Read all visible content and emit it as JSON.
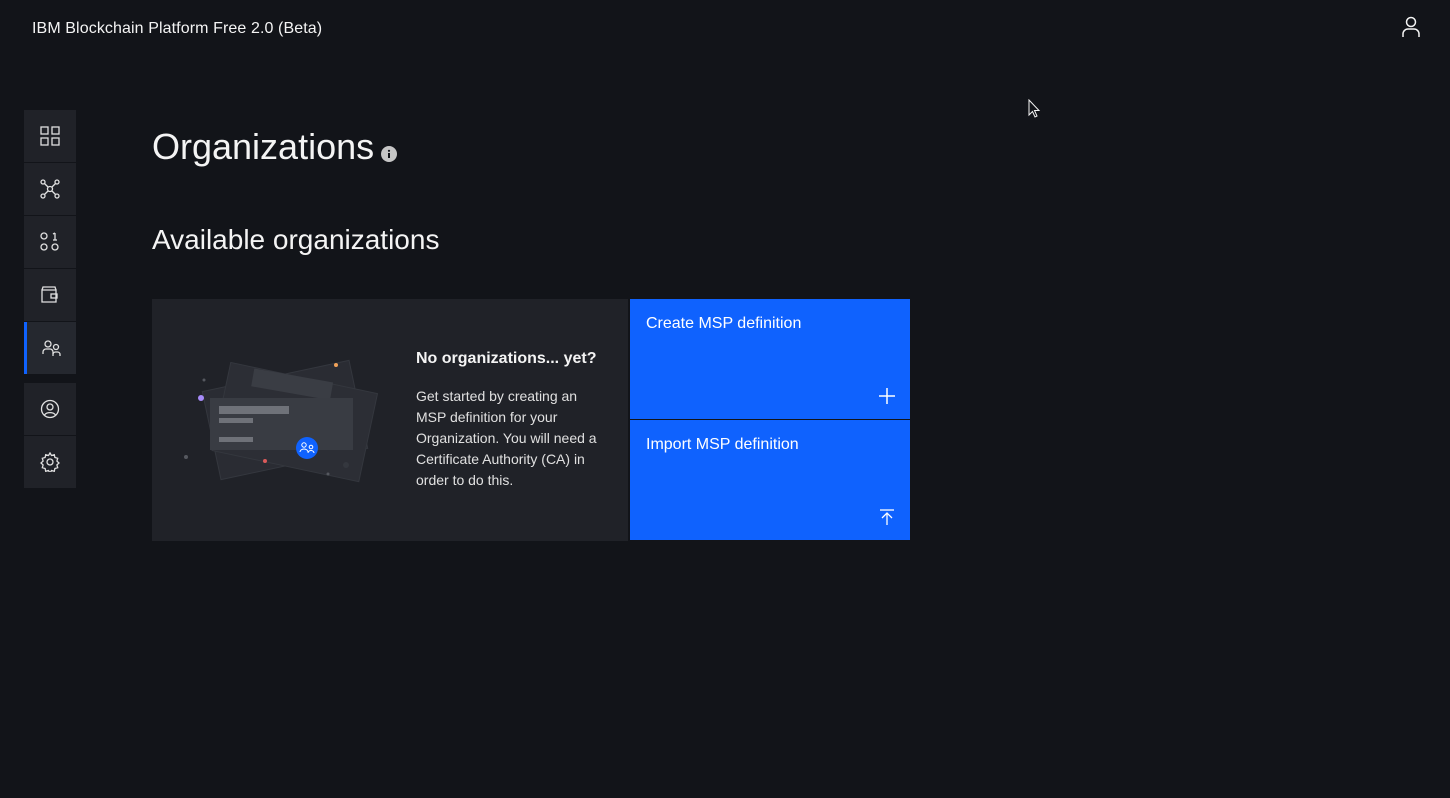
{
  "header": {
    "app_title": "IBM Blockchain Platform Free 2.0 (Beta)",
    "user_icon": "user-icon"
  },
  "sidebar": {
    "items": [
      {
        "icon": "dashboard-grid-icon",
        "active": false
      },
      {
        "icon": "network-nodes-icon",
        "active": false
      },
      {
        "icon": "smart-contracts-icon",
        "active": false
      },
      {
        "icon": "wallet-icon",
        "active": false
      },
      {
        "icon": "organizations-icon",
        "active": true
      },
      {
        "icon": "user-profile-icon",
        "active": false
      },
      {
        "icon": "settings-gear-icon",
        "active": false
      }
    ]
  },
  "main": {
    "page_title": "Organizations",
    "section_title": "Available organizations",
    "empty_state": {
      "heading": "No organizations... yet?",
      "text": "Get started by creating an MSP definition for your Organization. You will need a Certificate Authority (CA) in order to do this."
    },
    "tiles": {
      "create_label": "Create MSP definition",
      "import_label": "Import MSP definition"
    }
  },
  "colors": {
    "background": "#121419",
    "panel": "#202228",
    "accent": "#0f62fe"
  }
}
